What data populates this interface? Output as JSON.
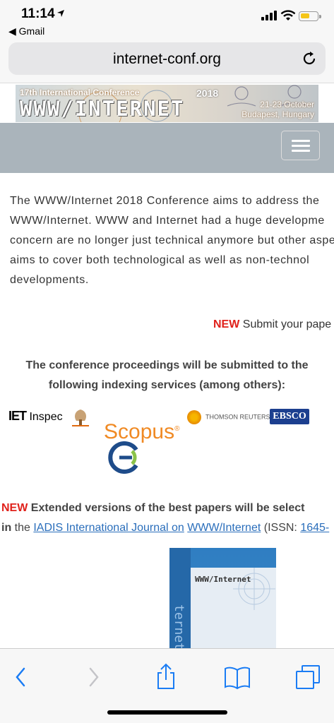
{
  "status": {
    "time": "11:14",
    "back_app": "◀ Gmail",
    "battery_level": 0.55,
    "accent": "#f5c518"
  },
  "browser": {
    "url": "internet-conf.org",
    "reload_icon": "reload-icon"
  },
  "banner": {
    "edition": "17th International Conference",
    "title": "WWW/INTERNET",
    "year": "2018",
    "dates": "21-23 October",
    "location": "Budapest, Hungary"
  },
  "nav": {
    "menu_icon": "hamburger-menu-icon"
  },
  "intro": {
    "lines": [
      "The WWW/Internet 2018 Conference aims to address the",
      "WWW/Internet. WWW and Internet had a huge developme",
      "concern are no longer just technical anymore but other aspe",
      "aims to cover both technological as well as non-technol",
      "developments."
    ]
  },
  "submit": {
    "badge": "NEW",
    "text": " Submit your pape"
  },
  "proceedings": {
    "line1": "The conference proceedings will be submitted to the",
    "line2": "following indexing services (among others):"
  },
  "logos": {
    "iet_mark": "IET",
    "iet_text": " Inspec",
    "scopus": "Scopus",
    "thomson": "THOMSON REUTERS",
    "ebsco": "EBSCO"
  },
  "extended": {
    "badge": "NEW",
    "text": " Extended versions of the best papers will be select",
    "prefix_bold": "in",
    "prefix": " the ",
    "link1": "IADIS International Journal on",
    "space": " ",
    "link2": "WWW/Internet",
    "middle": " (ISSN: ",
    "link3": "1645-"
  },
  "cover": {
    "title": "WWW/Internet",
    "spine": "ternet"
  },
  "toolbar": {
    "colors": {
      "active": "#1a7cf4",
      "disabled": "#c4c4c8"
    }
  }
}
